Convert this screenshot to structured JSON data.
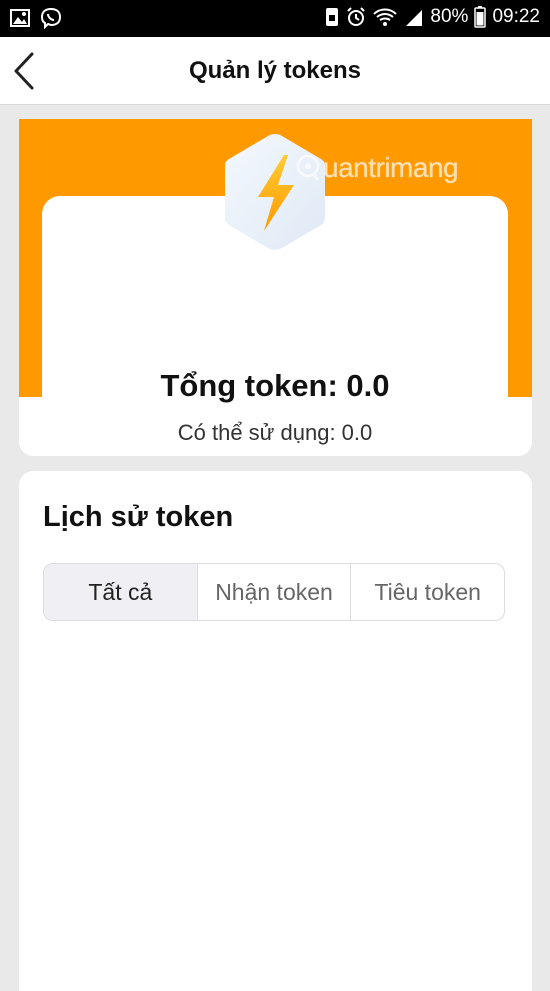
{
  "status_bar": {
    "battery": "80%",
    "time": "09:22",
    "icons": [
      "gallery-icon",
      "viber-icon",
      "alarm-icon",
      "wifi-icon",
      "signal-icon",
      "battery-icon"
    ]
  },
  "header": {
    "title": "Quản lý tokens",
    "back_icon": "chevron-left-icon"
  },
  "summary": {
    "total_label": "Tổng token: 0.0",
    "available_label": "Có thể sử dụng: 0.0",
    "badge_icon": "lightning-icon",
    "watermark": "uantrimang"
  },
  "history": {
    "title": "Lịch sử token",
    "tabs": [
      {
        "label": "Tất cả",
        "active": true
      },
      {
        "label": "Nhận token",
        "active": false
      },
      {
        "label": "Tiêu token",
        "active": false
      }
    ]
  },
  "colors": {
    "accent": "#ff9900",
    "background": "#e9e9e9",
    "tab_active": "#efeff4"
  }
}
